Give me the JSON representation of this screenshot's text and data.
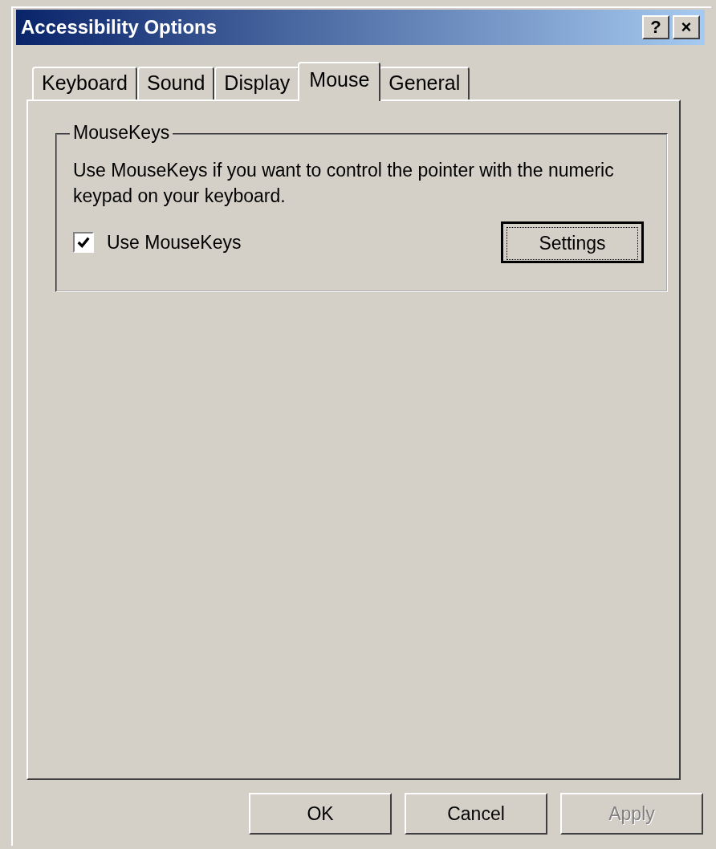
{
  "window": {
    "title": "Accessibility Options",
    "title_buttons": [
      "?",
      "×"
    ]
  },
  "tabs": [
    {
      "label": "Keyboard",
      "selected": false
    },
    {
      "label": "Sound",
      "selected": false
    },
    {
      "label": "Display",
      "selected": false
    },
    {
      "label": "Mouse",
      "selected": true
    },
    {
      "label": "General",
      "selected": false
    }
  ],
  "group": {
    "title": "MouseKeys",
    "description": "Use MouseKeys if you want to control the pointer with the numeric keypad on your keyboard.",
    "checkbox": {
      "label": "Use MouseKeys",
      "checked": true
    },
    "settings_button": {
      "label": "Settings",
      "focused": true
    }
  },
  "buttons": [
    {
      "label": "OK",
      "disabled": false
    },
    {
      "label": "Cancel",
      "disabled": false
    },
    {
      "label": "Apply",
      "disabled": true
    }
  ]
}
